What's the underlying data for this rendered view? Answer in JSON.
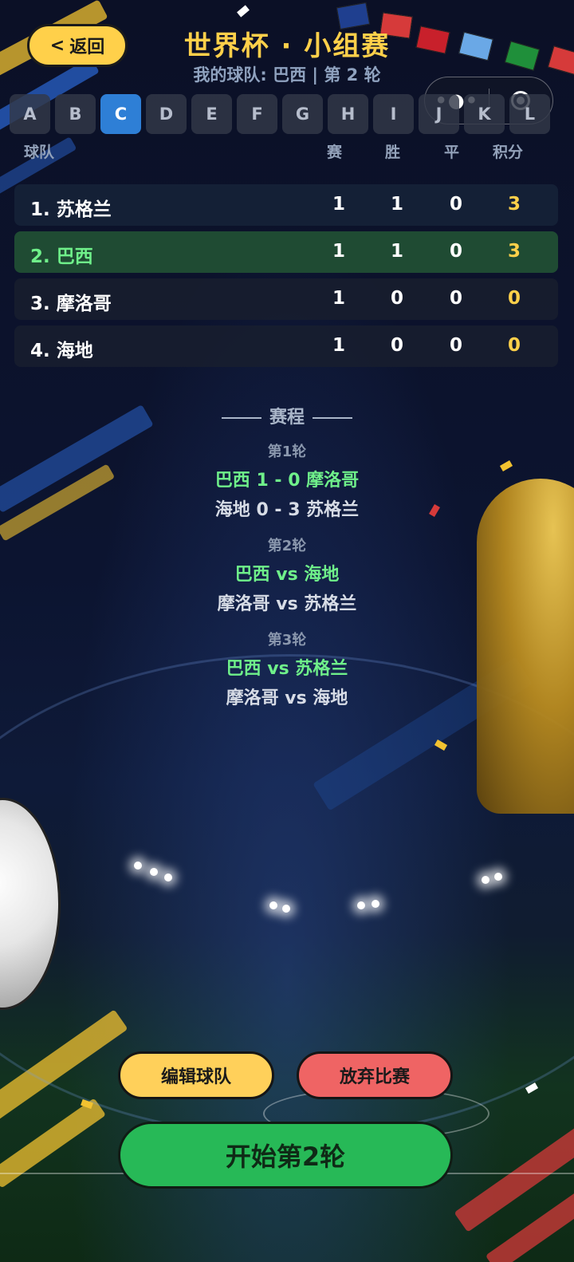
{
  "header": {
    "back_label": "返回",
    "back_icon": "chevron-left",
    "title": "世界杯 · 小组赛",
    "subtitle": "我的球队: 巴西 | 第 2 轮"
  },
  "capsule": {
    "more_icon": "more-dots",
    "close_icon": "target-close"
  },
  "groups": {
    "tabs": [
      "A",
      "B",
      "C",
      "D",
      "E",
      "F",
      "G",
      "H",
      "I",
      "J",
      "K",
      "L"
    ],
    "active": "C"
  },
  "table": {
    "headers": {
      "team": "球队",
      "played": "赛",
      "won": "胜",
      "drawn": "平",
      "points": "积分"
    },
    "rows": [
      {
        "name": "1. 苏格兰",
        "played": "1",
        "won": "1",
        "drawn": "0",
        "points": "3"
      },
      {
        "name": "2. 巴西",
        "played": "1",
        "won": "1",
        "drawn": "0",
        "points": "3"
      },
      {
        "name": "3. 摩洛哥",
        "played": "1",
        "won": "0",
        "drawn": "0",
        "points": "0"
      },
      {
        "name": "4. 海地",
        "played": "1",
        "won": "0",
        "drawn": "0",
        "points": "0"
      }
    ]
  },
  "schedule": {
    "title": "赛程",
    "rounds": [
      {
        "label": "第1轮",
        "matches": [
          "巴西 1 - 0 摩洛哥",
          "海地 0 - 3 苏格兰"
        ]
      },
      {
        "label": "第2轮",
        "matches": [
          "巴西 vs 海地",
          "摩洛哥 vs 苏格兰"
        ]
      },
      {
        "label": "第3轮",
        "matches": [
          "巴西 vs 苏格兰",
          "摩洛哥 vs 海地"
        ]
      }
    ]
  },
  "actions": {
    "edit_label": "编辑球队",
    "quit_label": "放弃比赛",
    "start_label": "开始第2轮"
  },
  "colors": {
    "accent_yellow": "#ffd04a",
    "my_team_green": "#6ff08a",
    "active_tab_blue": "#2e7fd6",
    "start_green": "#27b957",
    "quit_red": "#ef6464"
  }
}
